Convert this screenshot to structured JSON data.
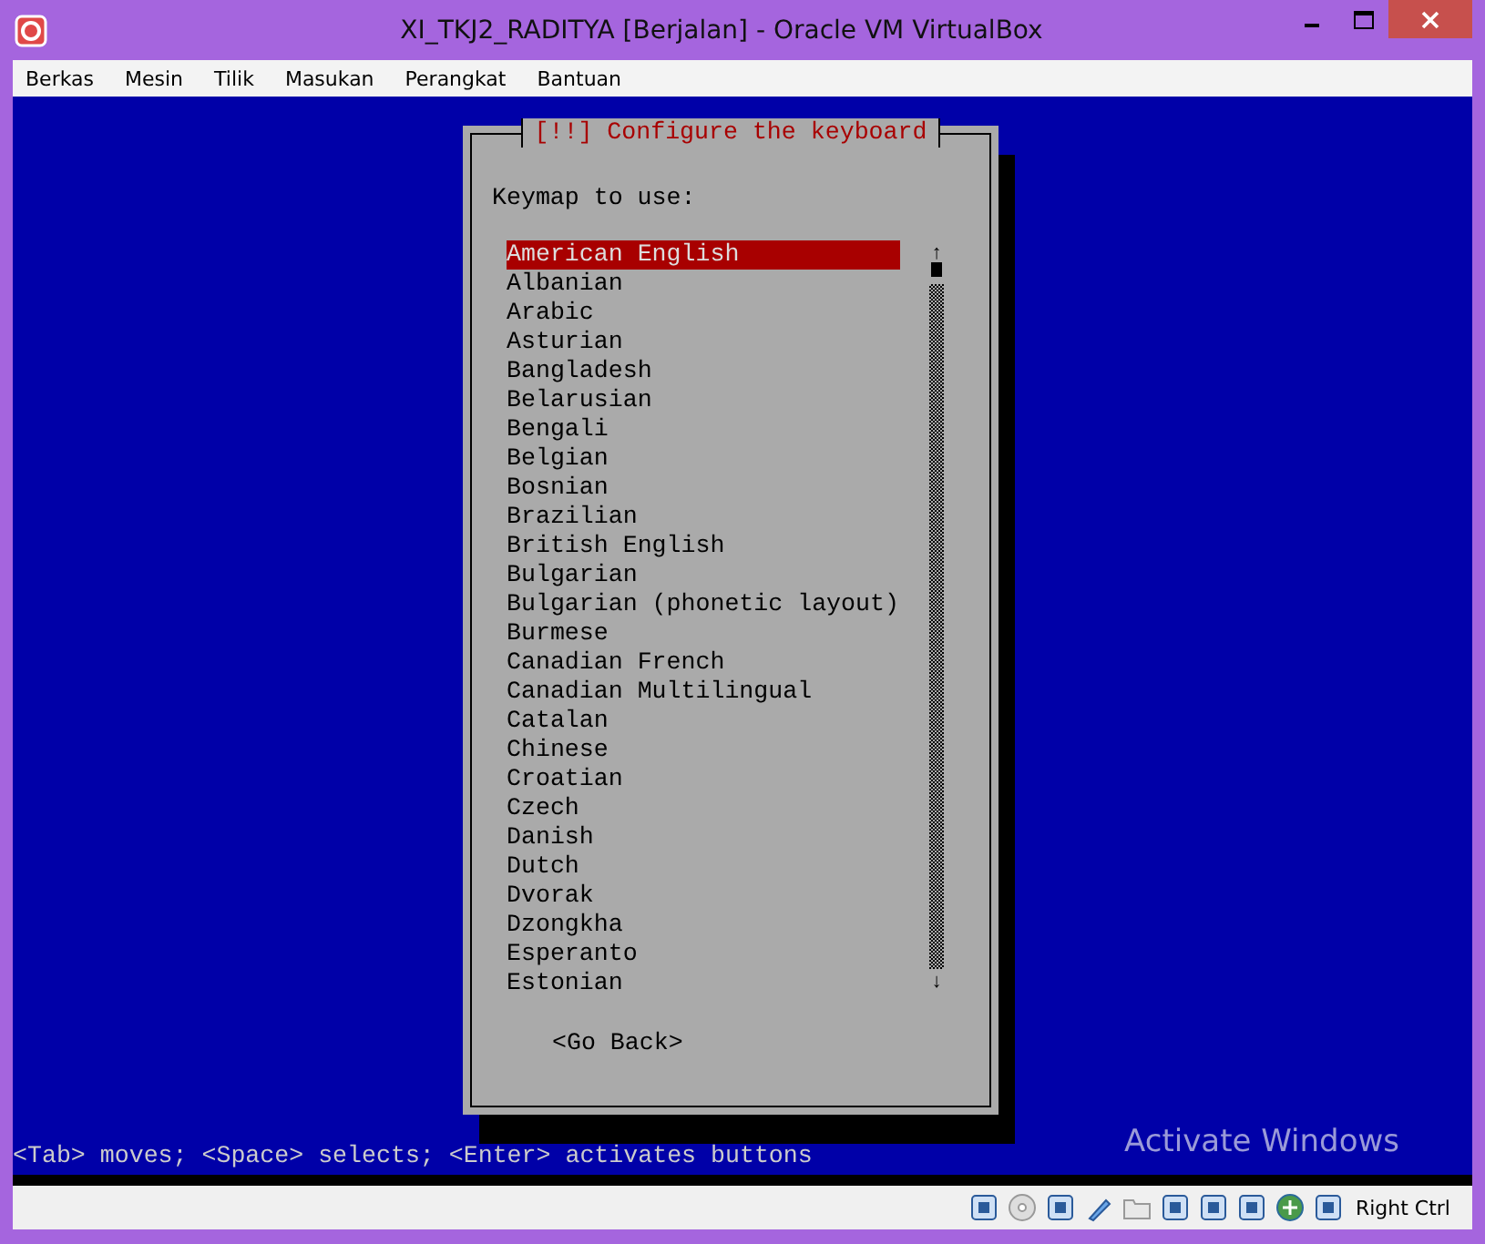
{
  "window": {
    "title": "XI_TKJ2_RADITYA [Berjalan] - Oracle VM VirtualBox"
  },
  "menu": [
    "Berkas",
    "Mesin",
    "Tilik",
    "Masukan",
    "Perangkat",
    "Bantuan"
  ],
  "dialog": {
    "title": "[!!] Configure the keyboard",
    "prompt": "Keymap to use:",
    "items": [
      {
        "label": "American English",
        "selected": true
      },
      {
        "label": "Albanian",
        "selected": false
      },
      {
        "label": "Arabic",
        "selected": false
      },
      {
        "label": "Asturian",
        "selected": false
      },
      {
        "label": "Bangladesh",
        "selected": false
      },
      {
        "label": "Belarusian",
        "selected": false
      },
      {
        "label": "Bengali",
        "selected": false
      },
      {
        "label": "Belgian",
        "selected": false
      },
      {
        "label": "Bosnian",
        "selected": false
      },
      {
        "label": "Brazilian",
        "selected": false
      },
      {
        "label": "British English",
        "selected": false
      },
      {
        "label": "Bulgarian",
        "selected": false
      },
      {
        "label": "Bulgarian (phonetic layout)",
        "selected": false
      },
      {
        "label": "Burmese",
        "selected": false
      },
      {
        "label": "Canadian French",
        "selected": false
      },
      {
        "label": "Canadian Multilingual",
        "selected": false
      },
      {
        "label": "Catalan",
        "selected": false
      },
      {
        "label": "Chinese",
        "selected": false
      },
      {
        "label": "Croatian",
        "selected": false
      },
      {
        "label": "Czech",
        "selected": false
      },
      {
        "label": "Danish",
        "selected": false
      },
      {
        "label": "Dutch",
        "selected": false
      },
      {
        "label": "Dvorak",
        "selected": false
      },
      {
        "label": "Dzongkha",
        "selected": false
      },
      {
        "label": "Esperanto",
        "selected": false
      },
      {
        "label": "Estonian",
        "selected": false
      }
    ],
    "scroll_up": "↑",
    "scroll_down": "↓",
    "button": "<Go Back>"
  },
  "help_line": "<Tab> moves; <Space> selects; <Enter> activates buttons",
  "activation_notice": "Activate Windows",
  "status_bar": {
    "host_key": "Right Ctrl"
  }
}
